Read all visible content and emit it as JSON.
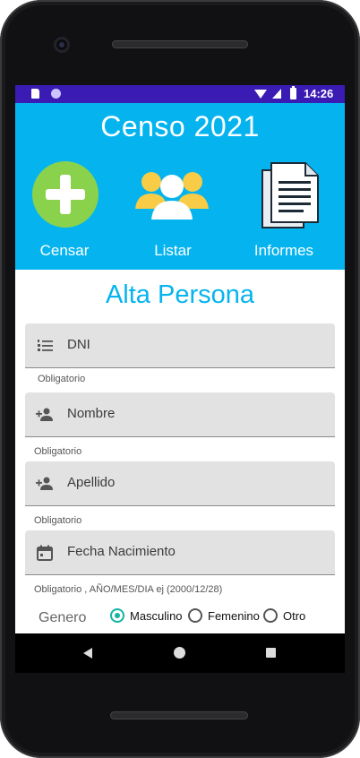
{
  "status_bar": {
    "time": "14:26"
  },
  "app": {
    "title": "Censo 2021"
  },
  "nav": [
    {
      "label": "Censar",
      "icon": "plus-circle-icon"
    },
    {
      "label": "Listar",
      "icon": "people-icon"
    },
    {
      "label": "Informes",
      "icon": "document-icon"
    }
  ],
  "form": {
    "title": "Alta Persona",
    "fields": [
      {
        "placeholder": "DNI",
        "helper": "Obligatorio",
        "icon": "list-number-icon"
      },
      {
        "placeholder": "Nombre",
        "helper": "Obligatorio",
        "icon": "person-add-icon"
      },
      {
        "placeholder": "Apellido",
        "helper": "Obligatorio",
        "icon": "person-add-icon"
      },
      {
        "placeholder": "Fecha Nacimiento",
        "helper": "Obligatorio , AÑO/MES/DIA ej (2000/12/28)",
        "icon": "calendar-icon"
      }
    ],
    "genero": {
      "label": "Genero",
      "options": [
        "Masculino",
        "Femenino",
        "Otro"
      ],
      "selected": "Masculino"
    }
  },
  "colors": {
    "header": "#05b4ef",
    "status_bar": "#3a1bb3",
    "accent_radio": "#14b3a3",
    "plus_green": "#8bd24c"
  }
}
